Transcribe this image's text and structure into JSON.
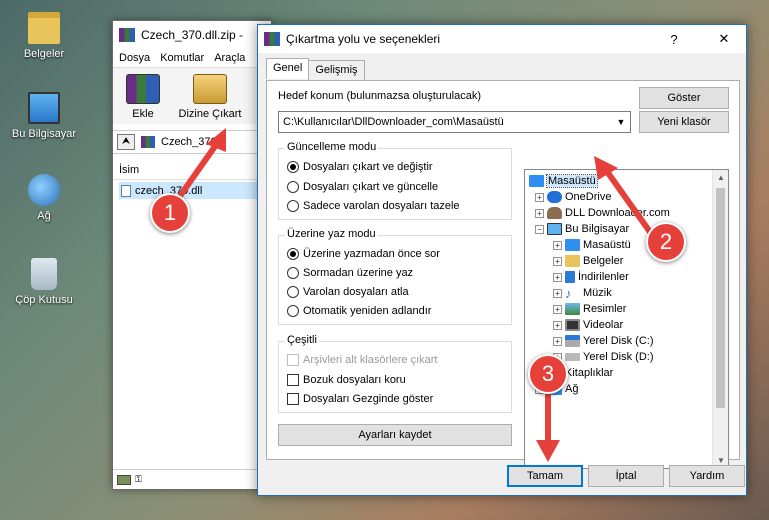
{
  "desktop": {
    "icons": [
      {
        "label": "Belgeler",
        "icon": "folder-icon"
      },
      {
        "label": "Bu Bilgisayar",
        "icon": "computer-icon"
      },
      {
        "label": "Ağ",
        "icon": "network-icon"
      },
      {
        "label": "Çöp Kutusu",
        "icon": "recycle-bin-icon"
      }
    ]
  },
  "winrar": {
    "title": "Czech_370.dll.zip -",
    "menu": [
      "Dosya",
      "Komutlar",
      "Araçla"
    ],
    "tools": [
      "Ekle",
      "Dizine Çıkart"
    ],
    "path": "Czech_370",
    "column_header": "İsim",
    "file": "czech_370.dll"
  },
  "dialog": {
    "title": "Çıkartma yolu ve seçenekleri",
    "help": "?",
    "close": "✕",
    "tabs": [
      "Genel",
      "Gelişmiş"
    ],
    "dest_label": "Hedef konum (bulunmazsa oluşturulacak)",
    "dest_value": "C:\\Kullanıcılar\\DllDownloader_com\\Masaüstü",
    "show_button": "Göster",
    "new_folder_button": "Yeni klasör",
    "update_group": {
      "title": "Güncelleme modu",
      "options": [
        "Dosyaları çıkart ve değiştir",
        "Dosyaları çıkart ve güncelle",
        "Sadece varolan dosyaları tazele"
      ],
      "selected": 0
    },
    "overwrite_group": {
      "title": "Üzerine yaz modu",
      "options": [
        "Üzerine yazmadan önce sor",
        "Sormadan üzerine yaz",
        "Varolan dosyaları atla",
        "Otomatik yeniden adlandır"
      ],
      "selected": 0
    },
    "misc_group": {
      "title": "Çeşitli",
      "options": [
        "Arşivleri alt klasörlere çıkart",
        "Bozuk dosyaları koru",
        "Dosyaları Gezginde göster"
      ]
    },
    "save_settings_button": "Ayarları kaydet",
    "tree": [
      {
        "label": "Masaüstü",
        "level": 0
      },
      {
        "label": "OneDrive",
        "level": 1
      },
      {
        "label": "DLL Downloader.com",
        "level": 1
      },
      {
        "label": "Bu Bilgisayar",
        "level": 1
      },
      {
        "label": "Masaüstü",
        "level": 2
      },
      {
        "label": "Belgeler",
        "level": 2
      },
      {
        "label": "İndirilenler",
        "level": 2
      },
      {
        "label": "Müzik",
        "level": 2
      },
      {
        "label": "Resimler",
        "level": 2
      },
      {
        "label": "Videolar",
        "level": 2
      },
      {
        "label": "Yerel Disk (C:)",
        "level": 2
      },
      {
        "label": "Yerel Disk (D:)",
        "level": 2
      },
      {
        "label": "Kitaplıklar",
        "level": 1
      },
      {
        "label": "Ağ",
        "level": 1
      }
    ],
    "ok_button": "Tamam",
    "cancel_button": "İptal",
    "help_button": "Yardım"
  },
  "annotations": [
    "1",
    "2",
    "3"
  ],
  "colors": {
    "annotation": "#e5413a",
    "selection": "#cce8ff",
    "accent": "#0078d7"
  }
}
